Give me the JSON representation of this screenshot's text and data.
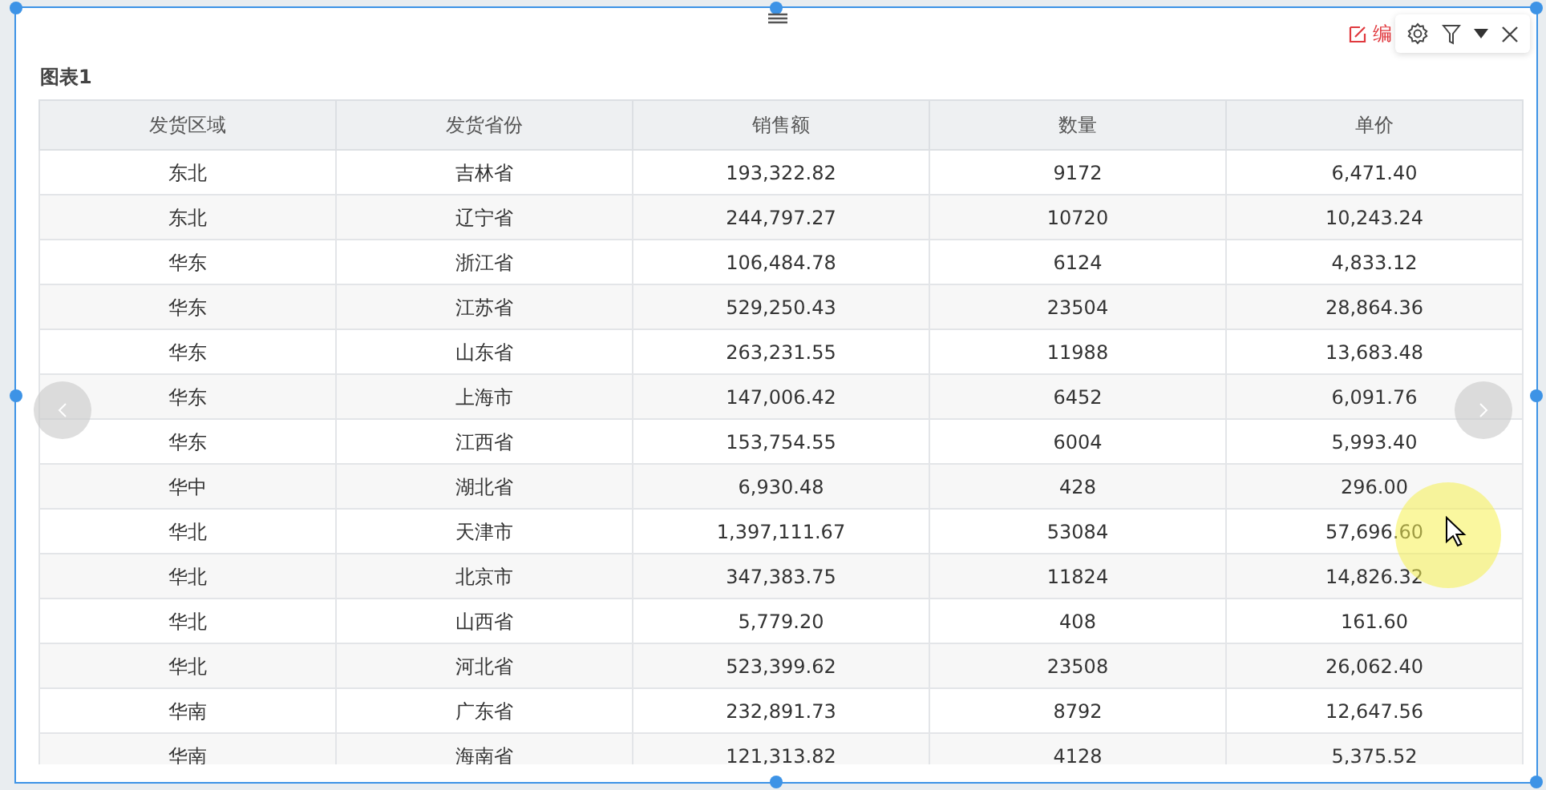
{
  "toolbar": {
    "edit_label": "编"
  },
  "chart": {
    "title": "图表1",
    "columns": [
      "发货区域",
      "发货省份",
      "销售额",
      "数量",
      "单价"
    ],
    "rows": [
      [
        "东北",
        "吉林省",
        "193,322.82",
        "9172",
        "6,471.40"
      ],
      [
        "东北",
        "辽宁省",
        "244,797.27",
        "10720",
        "10,243.24"
      ],
      [
        "华东",
        "浙江省",
        "106,484.78",
        "6124",
        "4,833.12"
      ],
      [
        "华东",
        "江苏省",
        "529,250.43",
        "23504",
        "28,864.36"
      ],
      [
        "华东",
        "山东省",
        "263,231.55",
        "11988",
        "13,683.48"
      ],
      [
        "华东",
        "上海市",
        "147,006.42",
        "6452",
        "6,091.76"
      ],
      [
        "华东",
        "江西省",
        "153,754.55",
        "6004",
        "5,993.40"
      ],
      [
        "华中",
        "湖北省",
        "6,930.48",
        "428",
        "296.00"
      ],
      [
        "华北",
        "天津市",
        "1,397,111.67",
        "53084",
        "57,696.60"
      ],
      [
        "华北",
        "北京市",
        "347,383.75",
        "11824",
        "14,826.32"
      ],
      [
        "华北",
        "山西省",
        "5,779.20",
        "408",
        "161.60"
      ],
      [
        "华北",
        "河北省",
        "523,399.62",
        "23508",
        "26,062.40"
      ],
      [
        "华南",
        "广东省",
        "232,891.73",
        "8792",
        "12,647.56"
      ],
      [
        "华南",
        "海南省",
        "121,313.82",
        "4128",
        "5,375.52"
      ]
    ]
  }
}
